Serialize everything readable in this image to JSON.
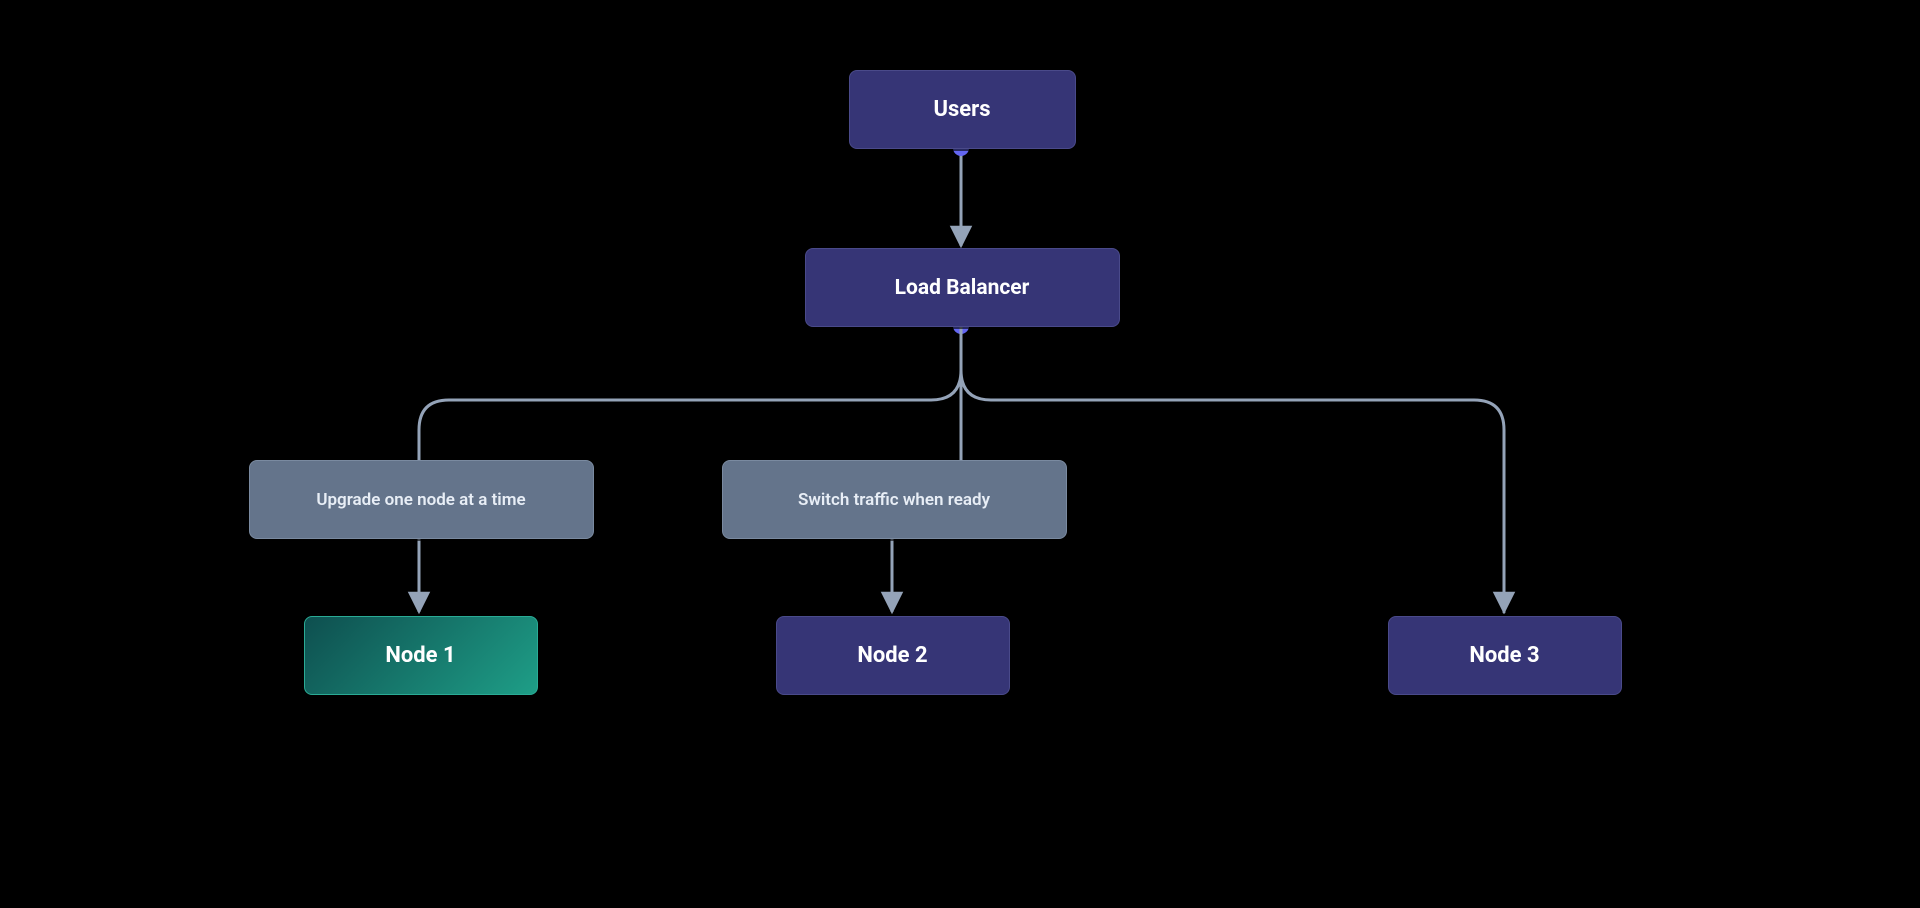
{
  "nodes": {
    "users": {
      "label": "Users"
    },
    "loadbalancer": {
      "label": "Load Balancer"
    },
    "note1": {
      "label": "Upgrade one node at a time"
    },
    "note2": {
      "label": "Switch traffic when ready"
    },
    "node1": {
      "label": "Node 1"
    },
    "node2": {
      "label": "Node 2"
    },
    "node3": {
      "label": "Node 3"
    }
  },
  "colors": {
    "line": "#94a3b8",
    "dot": "#6366f1"
  }
}
